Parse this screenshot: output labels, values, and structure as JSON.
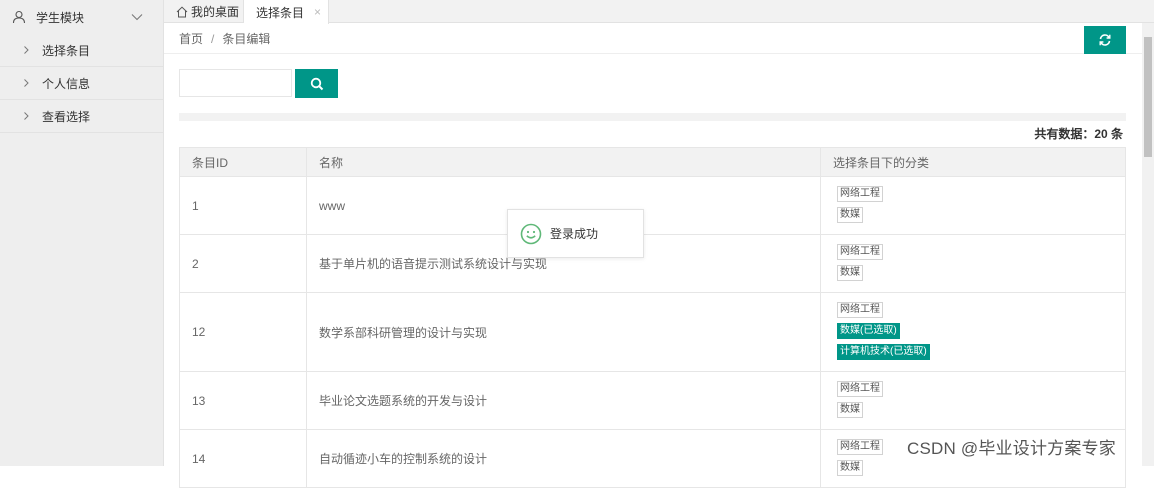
{
  "sidebar": {
    "header": "学生模块",
    "items": [
      {
        "label": "选择条目"
      },
      {
        "label": "个人信息"
      },
      {
        "label": "查看选择"
      }
    ]
  },
  "tabs": {
    "home": "我的桌面",
    "active": "选择条目",
    "close_glyph": "×"
  },
  "breadcrumb": {
    "home": "首页",
    "sep": "/",
    "current": "条目编辑"
  },
  "search": {
    "value": "",
    "placeholder": ""
  },
  "total": "共有数据：20 条",
  "table": {
    "headers": [
      "条目ID",
      "名称",
      "选择条目下的分类"
    ],
    "rows": [
      {
        "id": "1",
        "name": "www",
        "tags": [
          {
            "text": "网络工程",
            "selected": false
          },
          {
            "text": "数媒",
            "selected": false
          }
        ]
      },
      {
        "id": "2",
        "name": "基于单片机的语音提示测试系统设计与实现",
        "tags": [
          {
            "text": "网络工程",
            "selected": false
          },
          {
            "text": "数媒",
            "selected": false
          }
        ]
      },
      {
        "id": "12",
        "name": "数学系部科研管理的设计与实现",
        "tags": [
          {
            "text": "网络工程",
            "selected": false
          },
          {
            "text": "数媒(已选取)",
            "selected": true
          },
          {
            "text": "计算机技术(已选取)",
            "selected": true
          }
        ]
      },
      {
        "id": "13",
        "name": "毕业论文选题系统的开发与设计",
        "tags": [
          {
            "text": "网络工程",
            "selected": false
          },
          {
            "text": "数媒",
            "selected": false
          }
        ]
      },
      {
        "id": "14",
        "name": "自动循迹小车的控制系统的设计",
        "tags": [
          {
            "text": "网络工程",
            "selected": false
          },
          {
            "text": "数媒",
            "selected": false
          }
        ]
      }
    ]
  },
  "toast": {
    "text": "登录成功"
  },
  "watermark": "CSDN @毕业设计方案专家",
  "colors": {
    "accent": "#009688",
    "sidebar_bg": "#eeeeee",
    "toast_icon": "#5fb878"
  }
}
